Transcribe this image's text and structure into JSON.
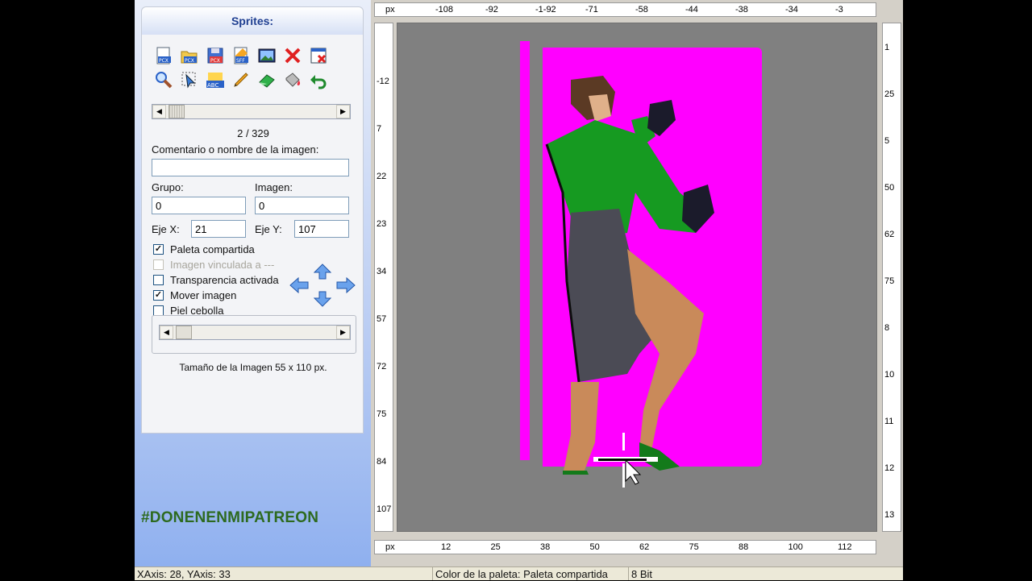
{
  "panel": {
    "title": "Sprites:",
    "toolbar_row1": [
      "new-pcx-icon",
      "open-pcx-icon",
      "save-pcx-icon",
      "sff-icon",
      "image-view-icon",
      "delete-icon",
      "close-image-icon"
    ],
    "toolbar_row2": [
      "zoom-icon",
      "select-tool-icon",
      "text-abc-icon",
      "pencil-icon",
      "eraser-icon",
      "fill-bucket-icon",
      "undo-icon"
    ],
    "counter": "2 / 329",
    "comment_label": "Comentario o nombre de la imagen:",
    "comment_value": "",
    "group_label": "Grupo:",
    "group_value": "0",
    "image_label": "Imagen:",
    "image_value": "0",
    "axis_x_label": "Eje X:",
    "axis_x_value": "21",
    "axis_y_label": "Eje Y:",
    "axis_y_value": "107",
    "checkboxes": [
      {
        "label": "Paleta compartida",
        "checked": true,
        "disabled": false
      },
      {
        "label": "Imagen vinculada a ---",
        "checked": false,
        "disabled": true
      },
      {
        "label": "Transparencia activada",
        "checked": false,
        "disabled": false
      },
      {
        "label": "Mover imagen",
        "checked": true,
        "disabled": false
      },
      {
        "label": "Piel cebolla",
        "checked": false,
        "disabled": false
      }
    ],
    "image_size": "Tamaño de la Imagen 55 x 110 px.",
    "hashtag": "#DONENENMIPATREON"
  },
  "rulers": {
    "unit": "px",
    "top_ticks": [
      "-108",
      "-92",
      "-1-92",
      "-71",
      "-58",
      "-44",
      "-38",
      "-34",
      "-3"
    ],
    "bottom_ticks": [
      "12",
      "25",
      "38",
      "50",
      "62",
      "75",
      "88",
      "100",
      "112"
    ],
    "left_ticks": [
      "-12",
      "7",
      "22",
      "23",
      "34",
      "57",
      "72",
      "75",
      "84",
      "107"
    ],
    "right_ticks": [
      "1",
      "25",
      "5",
      "50",
      "62",
      "75",
      "8",
      "10",
      "11",
      "12",
      "13"
    ]
  },
  "status": {
    "axes": "XAxis: 28, YAxis: 33",
    "palette": "Color de la paleta: Paleta compartida",
    "depth": "8 Bit"
  },
  "colors": {
    "transparent_bg": "#ff00ff",
    "canvas_bg": "#808080",
    "hashtag": "#2d6a1f"
  }
}
